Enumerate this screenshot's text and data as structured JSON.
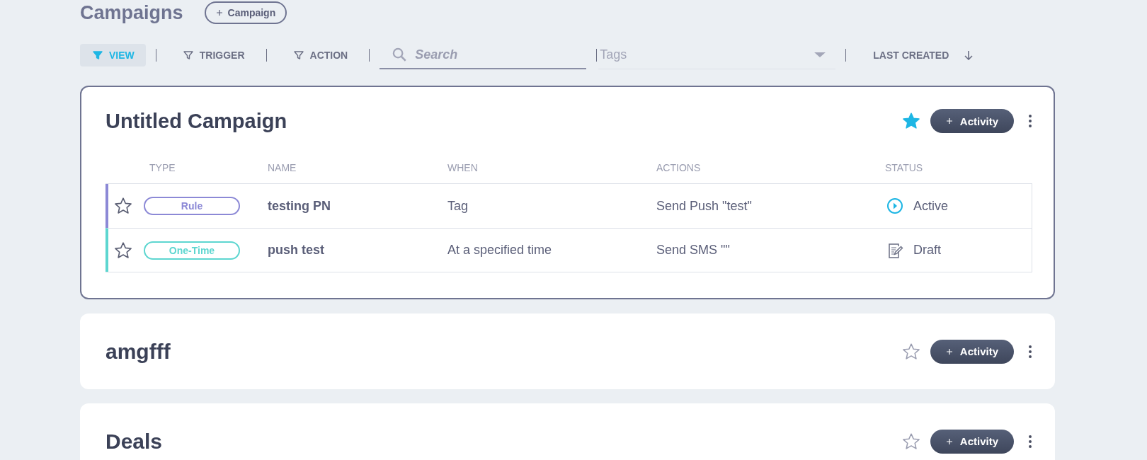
{
  "page_title": "Campaigns",
  "add_campaign_button": "Campaign",
  "filters": [
    {
      "label": "VIEW",
      "selected": true
    },
    {
      "label": "TRIGGER",
      "selected": false
    },
    {
      "label": "ACTION",
      "selected": false
    }
  ],
  "search": {
    "placeholder": "Search"
  },
  "tags": {
    "placeholder": "Tags"
  },
  "sort": {
    "label": "LAST CREATED"
  },
  "campaigns": [
    {
      "title": "Untitled Campaign",
      "starred": true,
      "expanded": true,
      "add_button": "Activity",
      "columns": [
        "TYPE",
        "NAME",
        "WHEN",
        "ACTIONS",
        "STATUS"
      ],
      "rows": [
        {
          "starred": false,
          "type": "Rule",
          "color": "#8c89d6",
          "name": "testing PN",
          "when": "Tag",
          "actions": "Send Push \"test\"",
          "status": "Active",
          "kind": "active"
        },
        {
          "starred": false,
          "type": "One-Time",
          "color": "#5dd6d0",
          "name": "push test",
          "when": "At a specified time",
          "actions": "Send SMS \"\"",
          "status": "Draft",
          "kind": "draft"
        }
      ]
    },
    {
      "title": "amgfff",
      "starred": false,
      "expanded": false,
      "add_button": "Activity"
    },
    {
      "title": "Deals",
      "starred": false,
      "expanded": false,
      "add_button": "Activity"
    }
  ]
}
